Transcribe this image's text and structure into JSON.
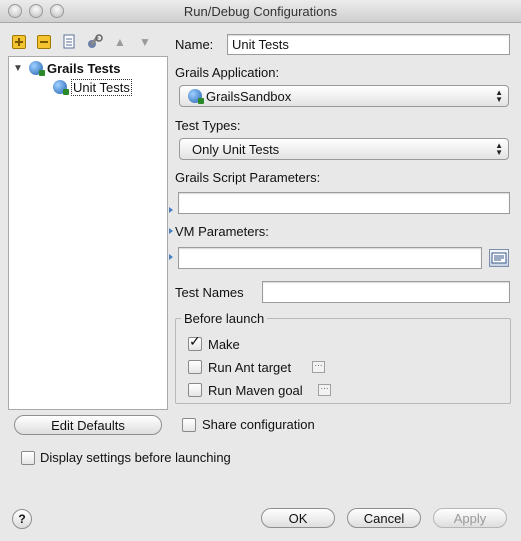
{
  "window": {
    "title": "Run/Debug Configurations"
  },
  "tree": {
    "root": "Grails Tests",
    "child": "Unit Tests"
  },
  "form": {
    "name_label": "Name:",
    "name_value": "Unit Tests",
    "app_label": "Grails Application:",
    "app_value": "GrailsSandbox",
    "test_types_label": "Test Types:",
    "test_types_value": "Only Unit Tests",
    "script_params_label": "Grails Script Parameters:",
    "script_params_value": "",
    "vm_params_label": "VM Parameters:",
    "vm_params_value": "",
    "test_names_label": "Test Names",
    "test_names_value": ""
  },
  "before_launch": {
    "title": "Before launch",
    "items": [
      {
        "label": "Make",
        "checked": true
      },
      {
        "label": "Run Ant target",
        "checked": false
      },
      {
        "label": "Run Maven goal",
        "checked": false
      }
    ]
  },
  "buttons": {
    "edit_defaults": "Edit Defaults",
    "share_config": "Share configuration",
    "display_settings": "Display settings before launching",
    "ok": "OK",
    "cancel": "Cancel",
    "apply": "Apply",
    "help": "?"
  },
  "glyphs": {
    "dots": "···",
    "checkmark": "✓",
    "tree_arrow": "▼",
    "up": "▲",
    "down": "▼"
  }
}
